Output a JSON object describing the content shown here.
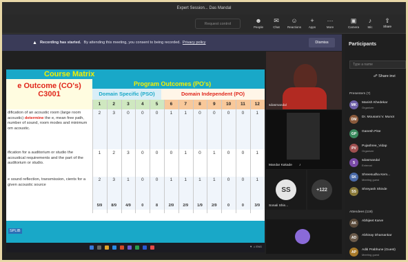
{
  "window": {
    "title": "Expert Session... Das Mandal",
    "app_name": "AudioSmart"
  },
  "toolbar": {
    "request_control": "Request control",
    "buttons": [
      {
        "label": "People",
        "icon": "people-icon"
      },
      {
        "label": "Chat",
        "icon": "chat-icon"
      },
      {
        "label": "Reactions",
        "icon": "reactions-icon"
      },
      {
        "label": "Apps",
        "icon": "apps-icon"
      },
      {
        "label": "More",
        "icon": "more-icon"
      },
      {
        "label": "Camera",
        "icon": "camera-icon"
      },
      {
        "label": "Mic",
        "icon": "mic-icon"
      },
      {
        "label": "Share",
        "icon": "share-icon"
      }
    ]
  },
  "banner": {
    "bold": "Recording has started.",
    "text": "By attending this meeting, you consent to being recorded.",
    "link": "Privacy policy",
    "dismiss": "Dismiss"
  },
  "slide": {
    "title": "Course Matrix",
    "co_header": [
      "e Outcome (CO's)",
      "C3001"
    ],
    "po_header": "Program Outcomes (PO's)",
    "pso_header": "Domain Specific (PSO)",
    "pi_header": "Domain Independent (PO)",
    "columns": [
      "1",
      "2",
      "3",
      "4",
      "5",
      "6",
      "7",
      "8",
      "9",
      "10",
      "11",
      "12"
    ],
    "rows": [
      {
        "text_pre": "dification of an acoustic room (large room acoustic) ",
        "text_red": "determine",
        " text_post": "",
        "text_rest": "the e, mean free path, number of sound, room modes and minimum om acoustic.",
        "values": [
          "2",
          "3",
          "0",
          "0",
          "0",
          "1",
          "1",
          "0",
          "0",
          "0",
          "0",
          "1"
        ]
      },
      {
        "text_pre": "ification for a auditorium or studio the acoustical requirements and the part of the auditorium or studio.",
        "text_red": "",
        "text_rest": "",
        "values": [
          "1",
          "2",
          "3",
          "0",
          "0",
          "0",
          "1",
          "0",
          "1",
          "0",
          "0",
          "1"
        ]
      },
      {
        "text_pre": "e sound reflection, transmission, cients for a given acoustic source",
        "text_red": "",
        "text_rest": "",
        "values": [
          "2",
          "3",
          "1",
          "0",
          "0",
          "1",
          "1",
          "1",
          "1",
          "0",
          "0",
          "1"
        ]
      }
    ],
    "totals": [
      "5/9",
      "8/9",
      "4/9",
      "0",
      "8",
      "2/9",
      "2/9",
      "1/9",
      "2/9",
      "0",
      "0",
      "3/9"
    ],
    "semester_label": "SPLIB"
  },
  "videos": [
    {
      "name": "sdasmandal"
    },
    {
      "name": "Mandar Kakade"
    },
    {
      "name": "Sonali Shin...",
      "initials": "SS"
    },
    {
      "name": "+122"
    }
  ],
  "panel": {
    "title": "Participants",
    "search_placeholder": "Type a name",
    "share_invite": "Share invi",
    "presenters_header": "Presenters (7)",
    "attendees_header": "Attendees (119)",
    "presenters": [
      {
        "name": "Manish Khedekar",
        "role": "Organizer",
        "initials": "MK",
        "color": "#6d5fa8"
      },
      {
        "name": "Dr. Mousami V. Munot",
        "role": "",
        "initials": "DM",
        "color": "#8b5a3c"
      },
      {
        "name": "Ganesh Pise",
        "role": "",
        "initials": "GP",
        "color": "#3b8a5e"
      },
      {
        "name": "Pujashree_Vidap",
        "role": "Organizer",
        "initials": "PV",
        "color": "#a05050"
      },
      {
        "name": "sdasmandal",
        "role": "External",
        "initials": "S",
        "color": "#7a4aa8"
      },
      {
        "name": "Shreesudha Kem...",
        "role": "Meeting guest",
        "initials": "SK",
        "color": "#4a6aa8"
      },
      {
        "name": "Shreyash Shinde",
        "role": "",
        "initials": "SS",
        "color": "#8a7a3a"
      }
    ],
    "attendees": [
      {
        "name": "Abhijeet Karve",
        "role": "",
        "initials": "AK",
        "color": "#5a4a3a"
      },
      {
        "name": "Abhinay Dhamankar",
        "role": "",
        "initials": "AD",
        "color": "#6a5a4a"
      },
      {
        "name": "Aditi Prabhune (Guest)",
        "role": "Meeting guest",
        "initials": "AP",
        "color": "#a87a2a"
      }
    ]
  }
}
